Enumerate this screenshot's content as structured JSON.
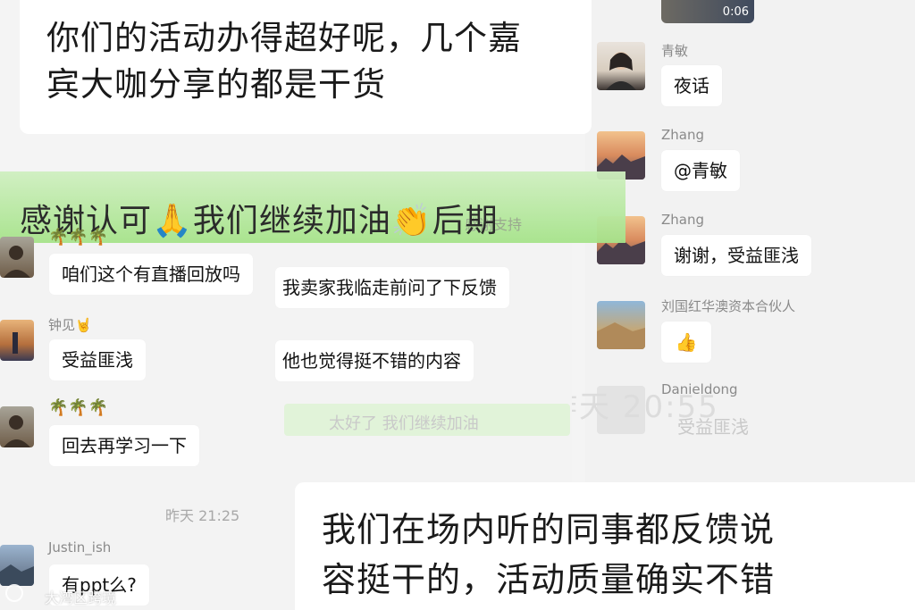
{
  "top_quote": {
    "line1": "你们的活动办得超好呢，几个嘉",
    "line2": "宾大咖分享的都是干货"
  },
  "banner": {
    "text": "感谢认可🙏我们继续加油👏后期",
    "ghost_text": "感谢支持"
  },
  "right_chat": {
    "video_time": "0:06",
    "msgs": [
      {
        "name": "青敏",
        "text": "夜话"
      },
      {
        "name": "Zhang",
        "text": "@青敏"
      },
      {
        "name": "Zhang",
        "text": "谢谢，受益匪浅"
      },
      {
        "name": "刘国红华澳资本合伙人",
        "text": "👍"
      },
      {
        "name": "Danieldong",
        "text": "受益匪浅"
      }
    ],
    "ghost_time": "昨天 20:55"
  },
  "left_chat": {
    "msgs": [
      {
        "name": "🌴🌴🌴",
        "text": "咱们这个有直播回放吗"
      },
      {
        "name": "钟见🤘",
        "text": "受益匪浅"
      },
      {
        "name": "🌴🌴🌴",
        "text": "回去再学习一下"
      }
    ],
    "timestamp": "昨天 21:25",
    "last_name": "Justin_ish",
    "last_text": "有ppt么?"
  },
  "middle_msgs": [
    "我卖家我临走前问了下反馈",
    "他也觉得挺不错的内容"
  ],
  "middle_ghost": "太好了 我们继续加油",
  "bottom_quote": {
    "line1": "我们在场内听的同事都反馈说",
    "line2": "容挺干的，活动质量确实不错"
  },
  "watermark": "大湾区跨境",
  "colors": {
    "green": "#95ec69",
    "banner": "#a6e38a",
    "bg": "#f3f3f3",
    "bubble": "#ffffff"
  }
}
